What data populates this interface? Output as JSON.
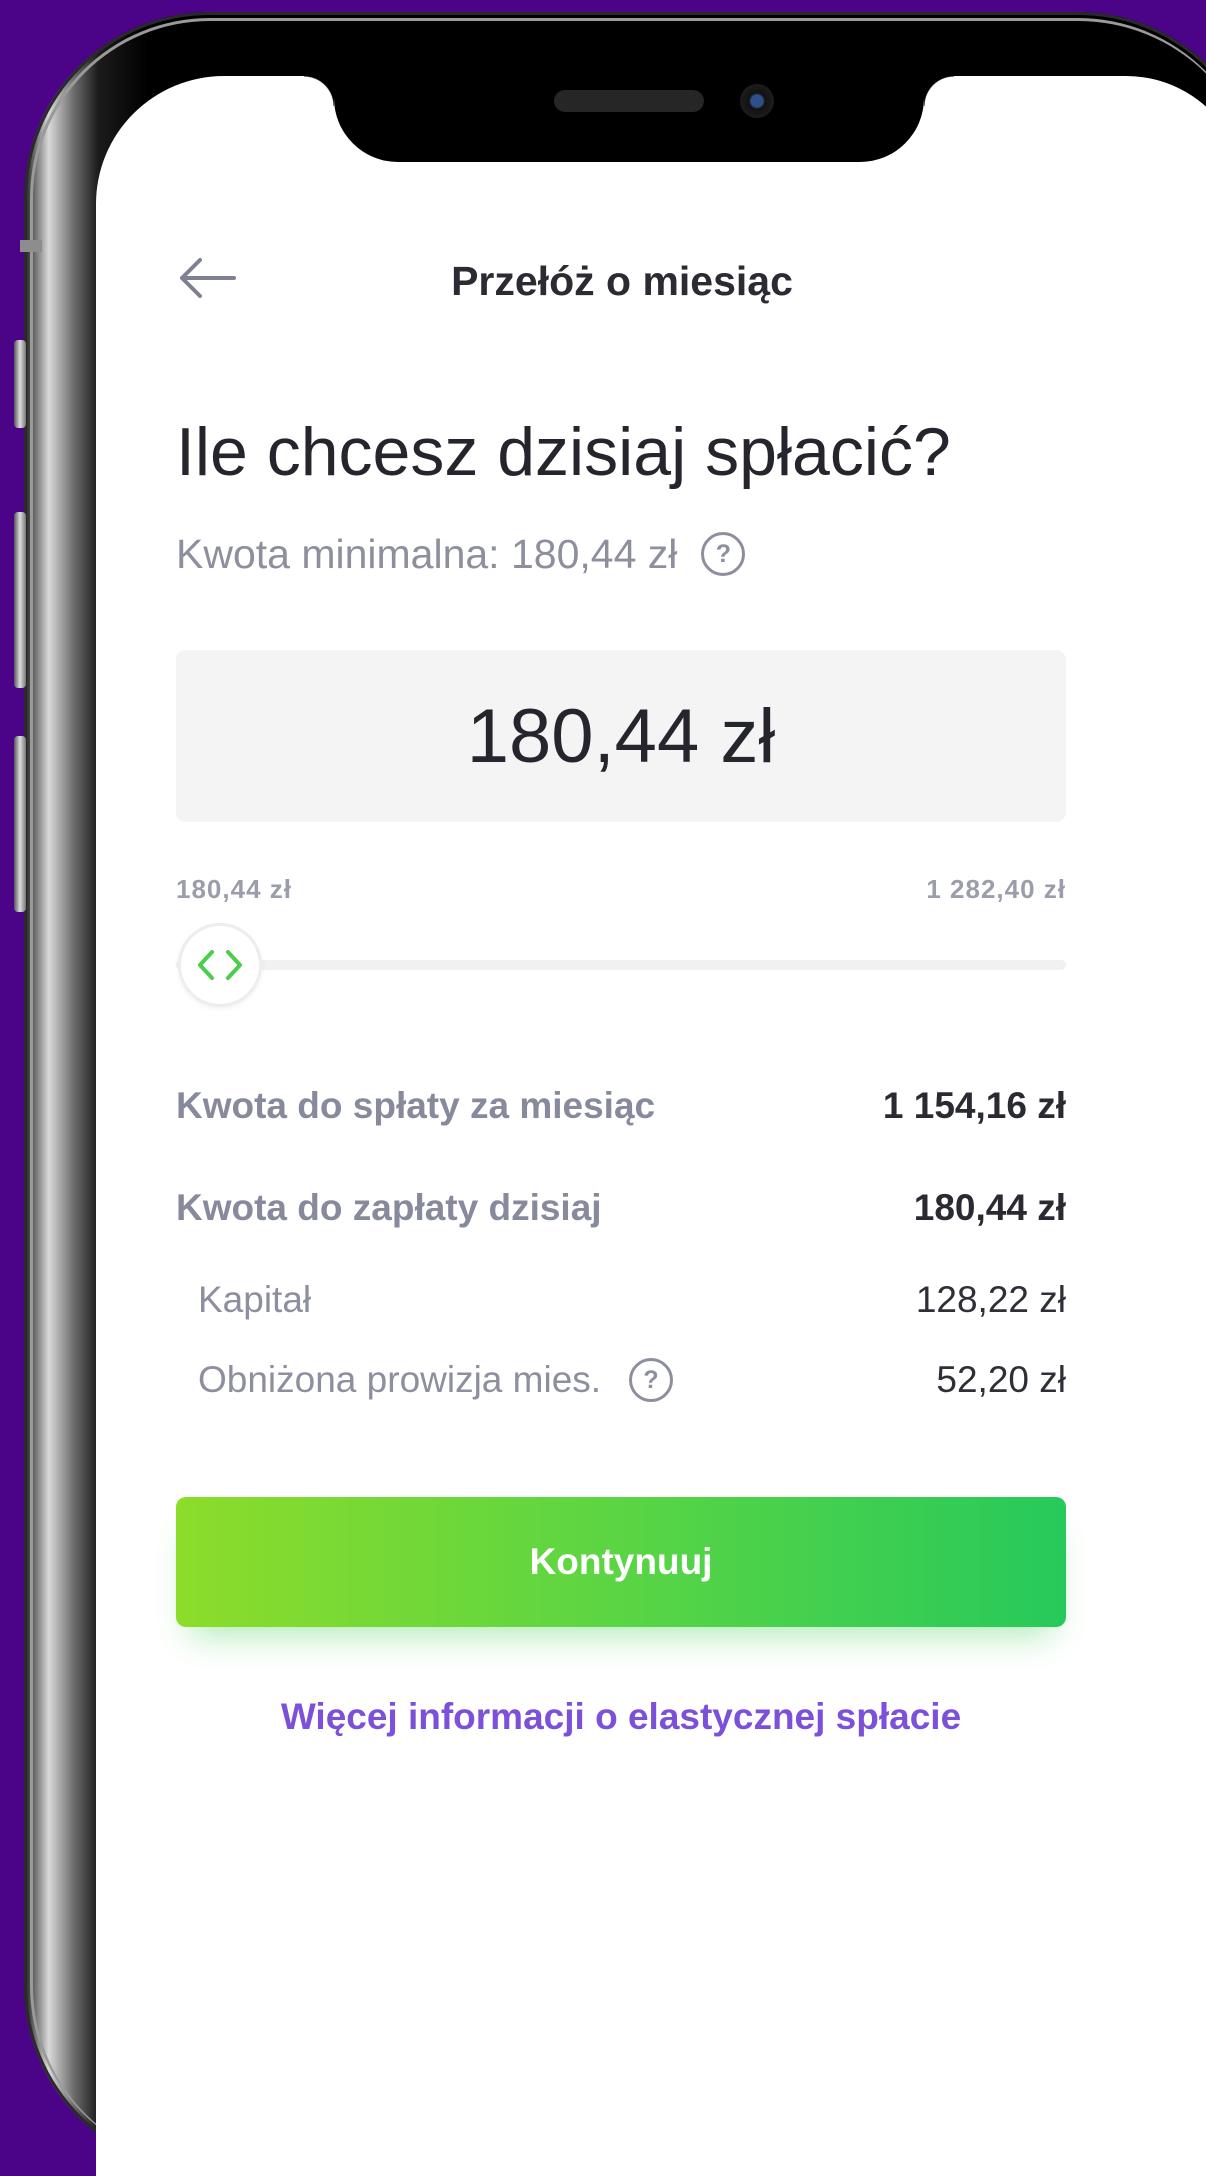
{
  "header": {
    "title": "Przełóż o miesiąc",
    "back_icon": "arrow-left-icon"
  },
  "main": {
    "question": "Ile chcesz dzisiaj spłacić?",
    "minimum_label": "Kwota minimalna: 180,44 zł",
    "help_symbol": "?",
    "amount_value": "180,44 zł",
    "slider": {
      "min_label": "180,44 zł",
      "max_label": "1 282,40 zł",
      "value_fraction": 0
    },
    "details": {
      "monthly_label": "Kwota do spłaty za miesiąc",
      "monthly_value": "1 154,16 zł",
      "today_label": "Kwota do zapłaty dzisiaj",
      "today_value": "180,44 zł",
      "capital_label": "Kapitał",
      "capital_value": "128,22 zł",
      "commission_label": "Obniżona prowizja mies.",
      "commission_value": "52,20 zł"
    },
    "continue_label": "Kontynuuj",
    "more_info_link": "Więcej informacji o elastycznej spłacie"
  },
  "colors": {
    "background": "#4b0387",
    "accent_green": "#4cd149",
    "link_purple": "#7c50d8",
    "text_dark": "#25252e",
    "text_muted": "#8d8f9f"
  }
}
